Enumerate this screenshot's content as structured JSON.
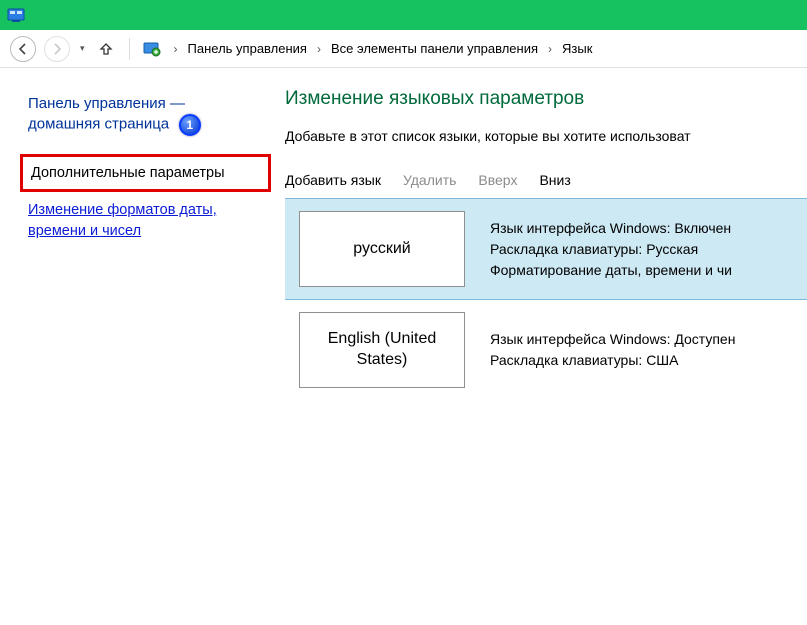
{
  "breadcrumb": {
    "level1": "Панель управления",
    "level2": "Все элементы панели управления",
    "level3": "Язык"
  },
  "sidebar": {
    "home_line1": "Панель управления —",
    "home_line2": "домашняя страница",
    "badge_num": "1",
    "highlighted": "Дополнительные параметры",
    "link_dtfmt": "Изменение форматов даты, времени и чисел"
  },
  "main": {
    "title": "Изменение языковых параметров",
    "desc": "Добавьте в этот список языки, которые вы хотите использоват"
  },
  "toolbar": {
    "add": "Добавить язык",
    "remove": "Удалить",
    "up": "Вверх",
    "down": "Вниз"
  },
  "langs": [
    {
      "name": "русский",
      "info1": "Язык интерфейса Windows: Включен",
      "info2": "Раскладка клавиатуры: Русская",
      "info3": "Форматирование даты, времени и чи",
      "selected": true
    },
    {
      "name": "English (United States)",
      "info1": "Язык интерфейса Windows: Доступен",
      "info2": "Раскладка клавиатуры: США",
      "info3": "",
      "selected": false
    }
  ]
}
